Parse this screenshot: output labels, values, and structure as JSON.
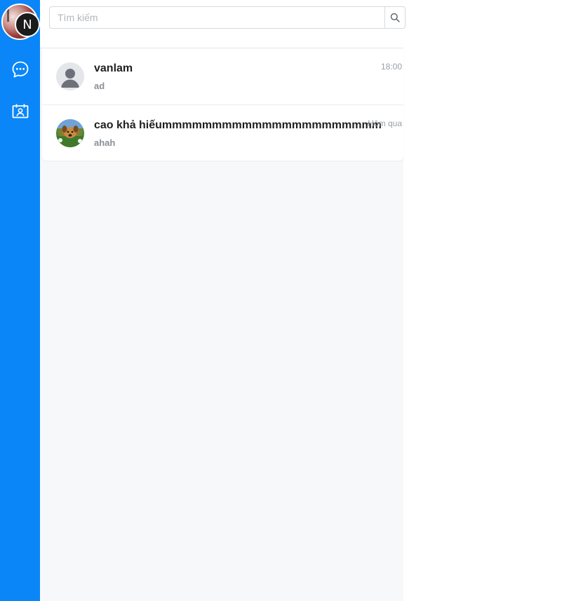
{
  "sidebar": {
    "badge_letter": "N",
    "items": [
      {
        "icon": "chat-bubble-icon"
      },
      {
        "icon": "contacts-book-icon"
      }
    ],
    "background_color": "#0a86f8"
  },
  "search": {
    "placeholder": "Tìm kiếm",
    "value": "",
    "button_icon": "search-icon"
  },
  "conversations": [
    {
      "name": "vanlam",
      "preview": "ad",
      "time": "18:00",
      "avatar": "default-user-avatar"
    },
    {
      "name": "cao khả hiếummmmmmmmmmmmmmmmmmmmmm",
      "preview": "ahah",
      "time": "Hôm qua",
      "avatar": "dog-photo-avatar"
    }
  ]
}
